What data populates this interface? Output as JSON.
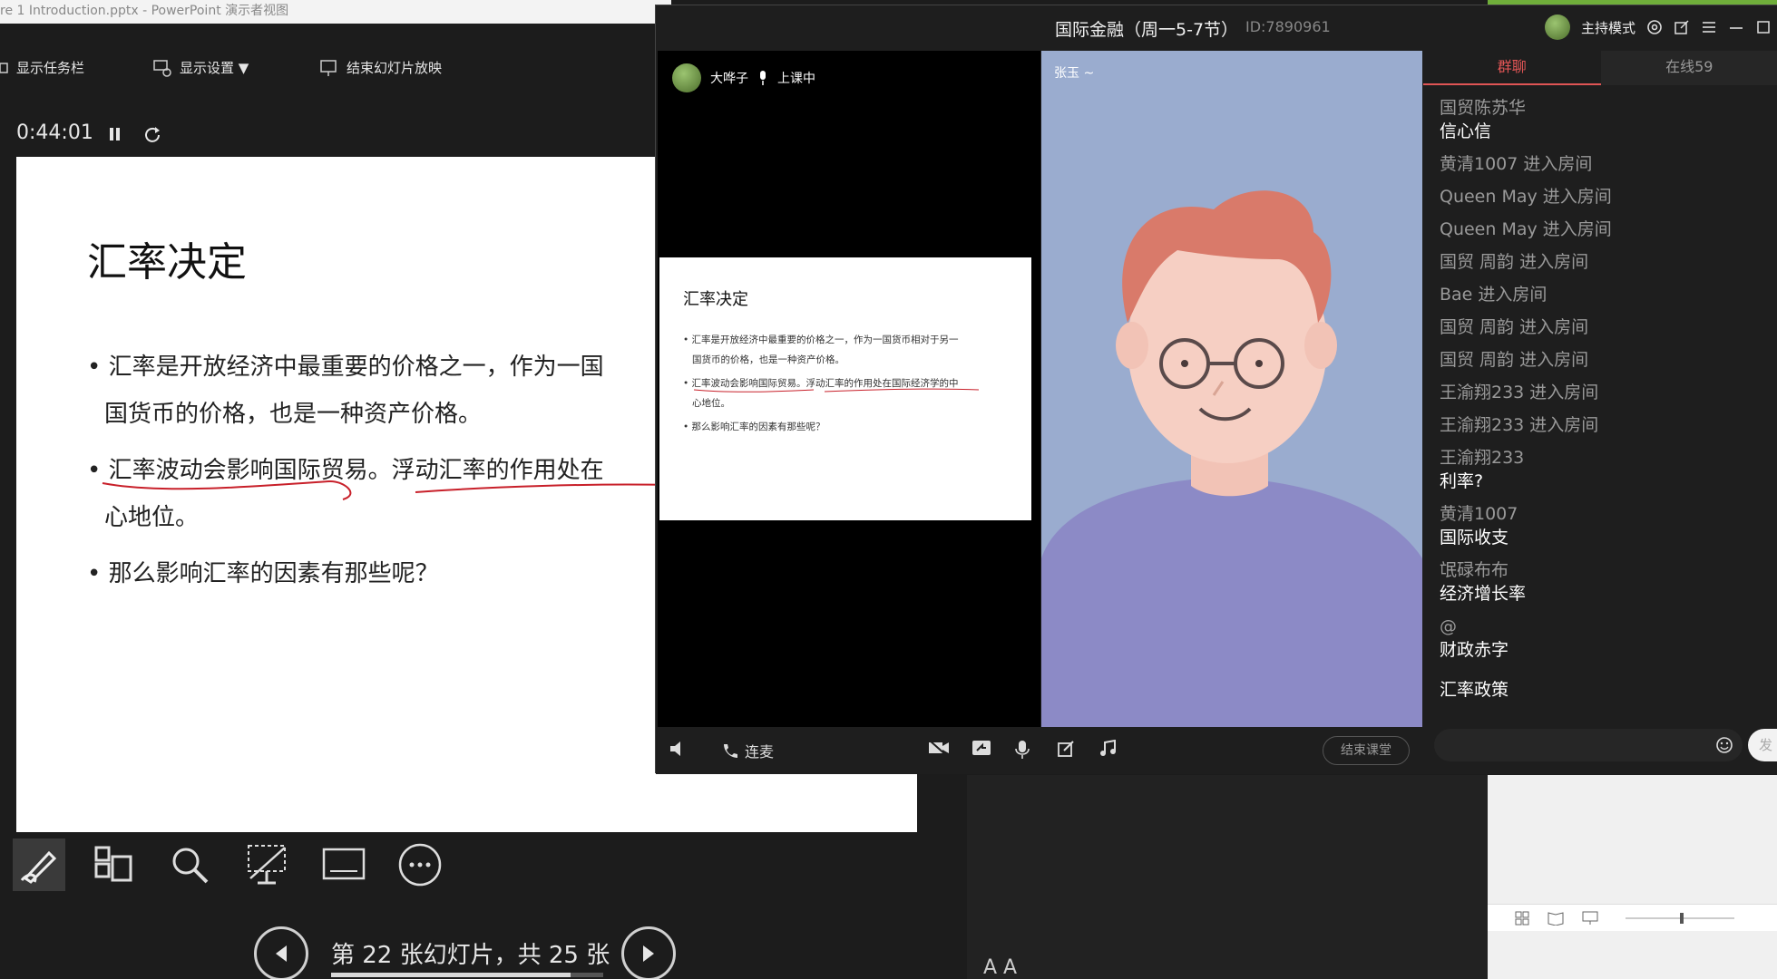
{
  "ppt": {
    "window_title": "re 1 Introduction.pptx - PowerPoint 演示者视图",
    "toolbar": {
      "show_taskbar": "显示任务栏",
      "display_settings": "显示设置 ▼",
      "end_slideshow": "结束幻灯片放映"
    },
    "timer": "0:44:01",
    "slide": {
      "title": "汇率决定",
      "bullets": [
        "汇率是开放经济中最重要的价格之一，作为一国",
        "国货币的价格，也是一种资产价格。",
        "汇率波动会影响国际贸易。浮动汇率的作用处在",
        "心地位。",
        "那么影响汇率的因素有那些呢？"
      ]
    },
    "slide_counter": "第 22 张幻灯片，共 25 张",
    "progress": 0.88,
    "notes_font_buttons": "A  A"
  },
  "live": {
    "class_title": "国际金融（周一5-7节）",
    "class_id": "ID:7890961",
    "host_mode": "主持模式",
    "teacher_name": "大哗子",
    "teacher_status": "上课中",
    "student_name": "张玉 ~",
    "mini_slide": {
      "title": "汇率决定",
      "lines": [
        "• 汇率是开放经济中最重要的价格之一，作为一国货币相对于另一",
        "国货币的价格，也是一种资产价格。",
        "• 汇率波动会影响国际贸易。浮动汇率的作用处在国际经济学的中",
        "心地位。",
        "• 那么影响汇率的因素有那些呢？"
      ]
    },
    "bottom": {
      "mic_link": "连麦",
      "end_class": "结束课堂"
    },
    "chat": {
      "tabs": [
        "群聊",
        "在线59"
      ],
      "messages": [
        {
          "who": "国贸陈苏华",
          "text": "信心信"
        },
        {
          "who": "黄清1007 进入房间",
          "text": ""
        },
        {
          "who": "Queen May    进入房间",
          "text": ""
        },
        {
          "who": "Queen May    进入房间",
          "text": ""
        },
        {
          "who": "国贸 周韵 进入房间",
          "text": ""
        },
        {
          "who": "Bae 进入房间",
          "text": ""
        },
        {
          "who": "国贸 周韵 进入房间",
          "text": ""
        },
        {
          "who": "国贸 周韵 进入房间",
          "text": ""
        },
        {
          "who": "王渝翔233 进入房间",
          "text": ""
        },
        {
          "who": "王渝翔233 进入房间",
          "text": ""
        },
        {
          "who": "王渝翔233",
          "text": "利率?"
        },
        {
          "who": "黄清1007",
          "text": "国际收支"
        },
        {
          "who": "氓碌布布",
          "text": "经济增长率"
        },
        {
          "who": "@",
          "text": "财政赤字"
        },
        {
          "who": "",
          "text": "汇率政策"
        }
      ],
      "send_label": "发"
    }
  }
}
